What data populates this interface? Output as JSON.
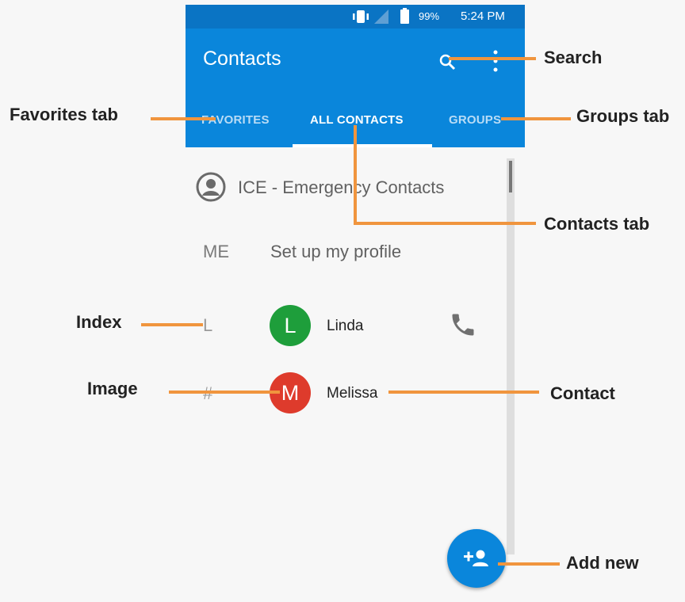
{
  "status_bar": {
    "battery": "99%",
    "time": "5:24 PM"
  },
  "app_bar": {
    "title": "Contacts"
  },
  "tabs": [
    {
      "label": "FAVORITES",
      "active": false
    },
    {
      "label": "ALL CONTACTS",
      "active": true
    },
    {
      "label": "GROUPS",
      "active": false
    }
  ],
  "list": {
    "ice": "ICE - Emergency Contacts",
    "me_label": "ME",
    "me_action": "Set up my profile",
    "contacts": [
      {
        "index": "L",
        "initial": "L",
        "name": "Linda",
        "avatar_color": "#1e9e3b"
      },
      {
        "index": "#",
        "initial": "M",
        "name": "Melissa",
        "avatar_color": "#de3b2c"
      }
    ]
  },
  "callouts": {
    "search": "Search",
    "favorites": "Favorites tab",
    "groups": "Groups tab",
    "contacts_tab": "Contacts tab",
    "index": "Index",
    "image": "Image",
    "contact": "Contact",
    "add_new": "Add new"
  },
  "colors": {
    "primary": "#0a86db",
    "status_bar": "#0a74c4",
    "callout_line": "#f0953e"
  },
  "icons": {
    "vibrate": "vibrate-icon",
    "signal": "signal-icon",
    "battery": "battery-icon",
    "search": "search-icon",
    "overflow": "more-vert-icon",
    "ice": "account-circle-icon",
    "phone": "phone-icon",
    "fab": "person-add-icon"
  }
}
